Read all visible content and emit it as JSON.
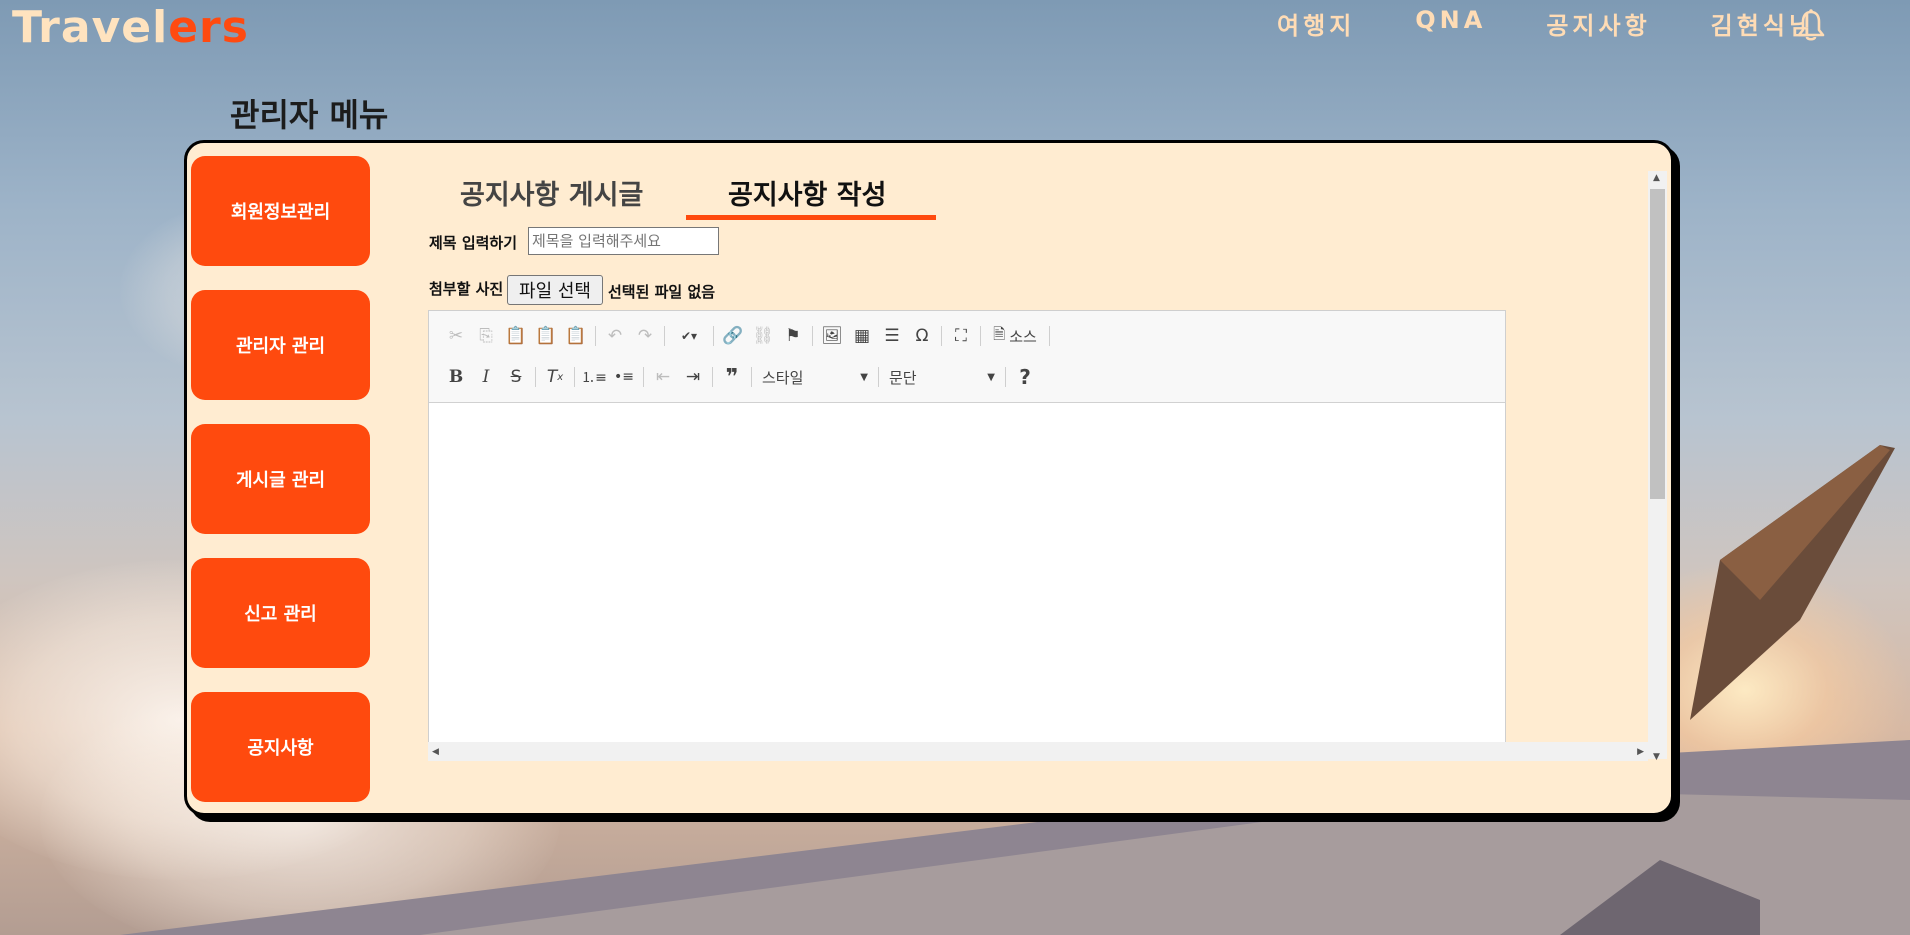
{
  "header": {
    "logo_part1": "Travel",
    "logo_part2": "ers",
    "nav": [
      "여행지",
      "QNA",
      "공지사항",
      "김현식님"
    ]
  },
  "page_title": "관리자 메뉴",
  "sidebar": {
    "items": [
      "회원정보관리",
      "관리자 관리",
      "게시글 관리",
      "신고 관리",
      "공지사항"
    ]
  },
  "tabs": {
    "list": "공지사항 게시글",
    "write": "공지사항 작성",
    "active": "공지사항 작성"
  },
  "form": {
    "title_label": "제목 입력하기",
    "title_placeholder": "제목을 입력해주세요",
    "attach_label": "첨부할 사진",
    "file_button": "파일 선택",
    "file_status": "선택된 파일 없음"
  },
  "editor": {
    "source_label": "소스",
    "style_combo": "스타일",
    "format_combo": "문단",
    "help": "?"
  },
  "colors": {
    "accent": "#ff4a0e",
    "panel_bg": "#ffecd1",
    "logo_light": "#ffe3bf"
  }
}
